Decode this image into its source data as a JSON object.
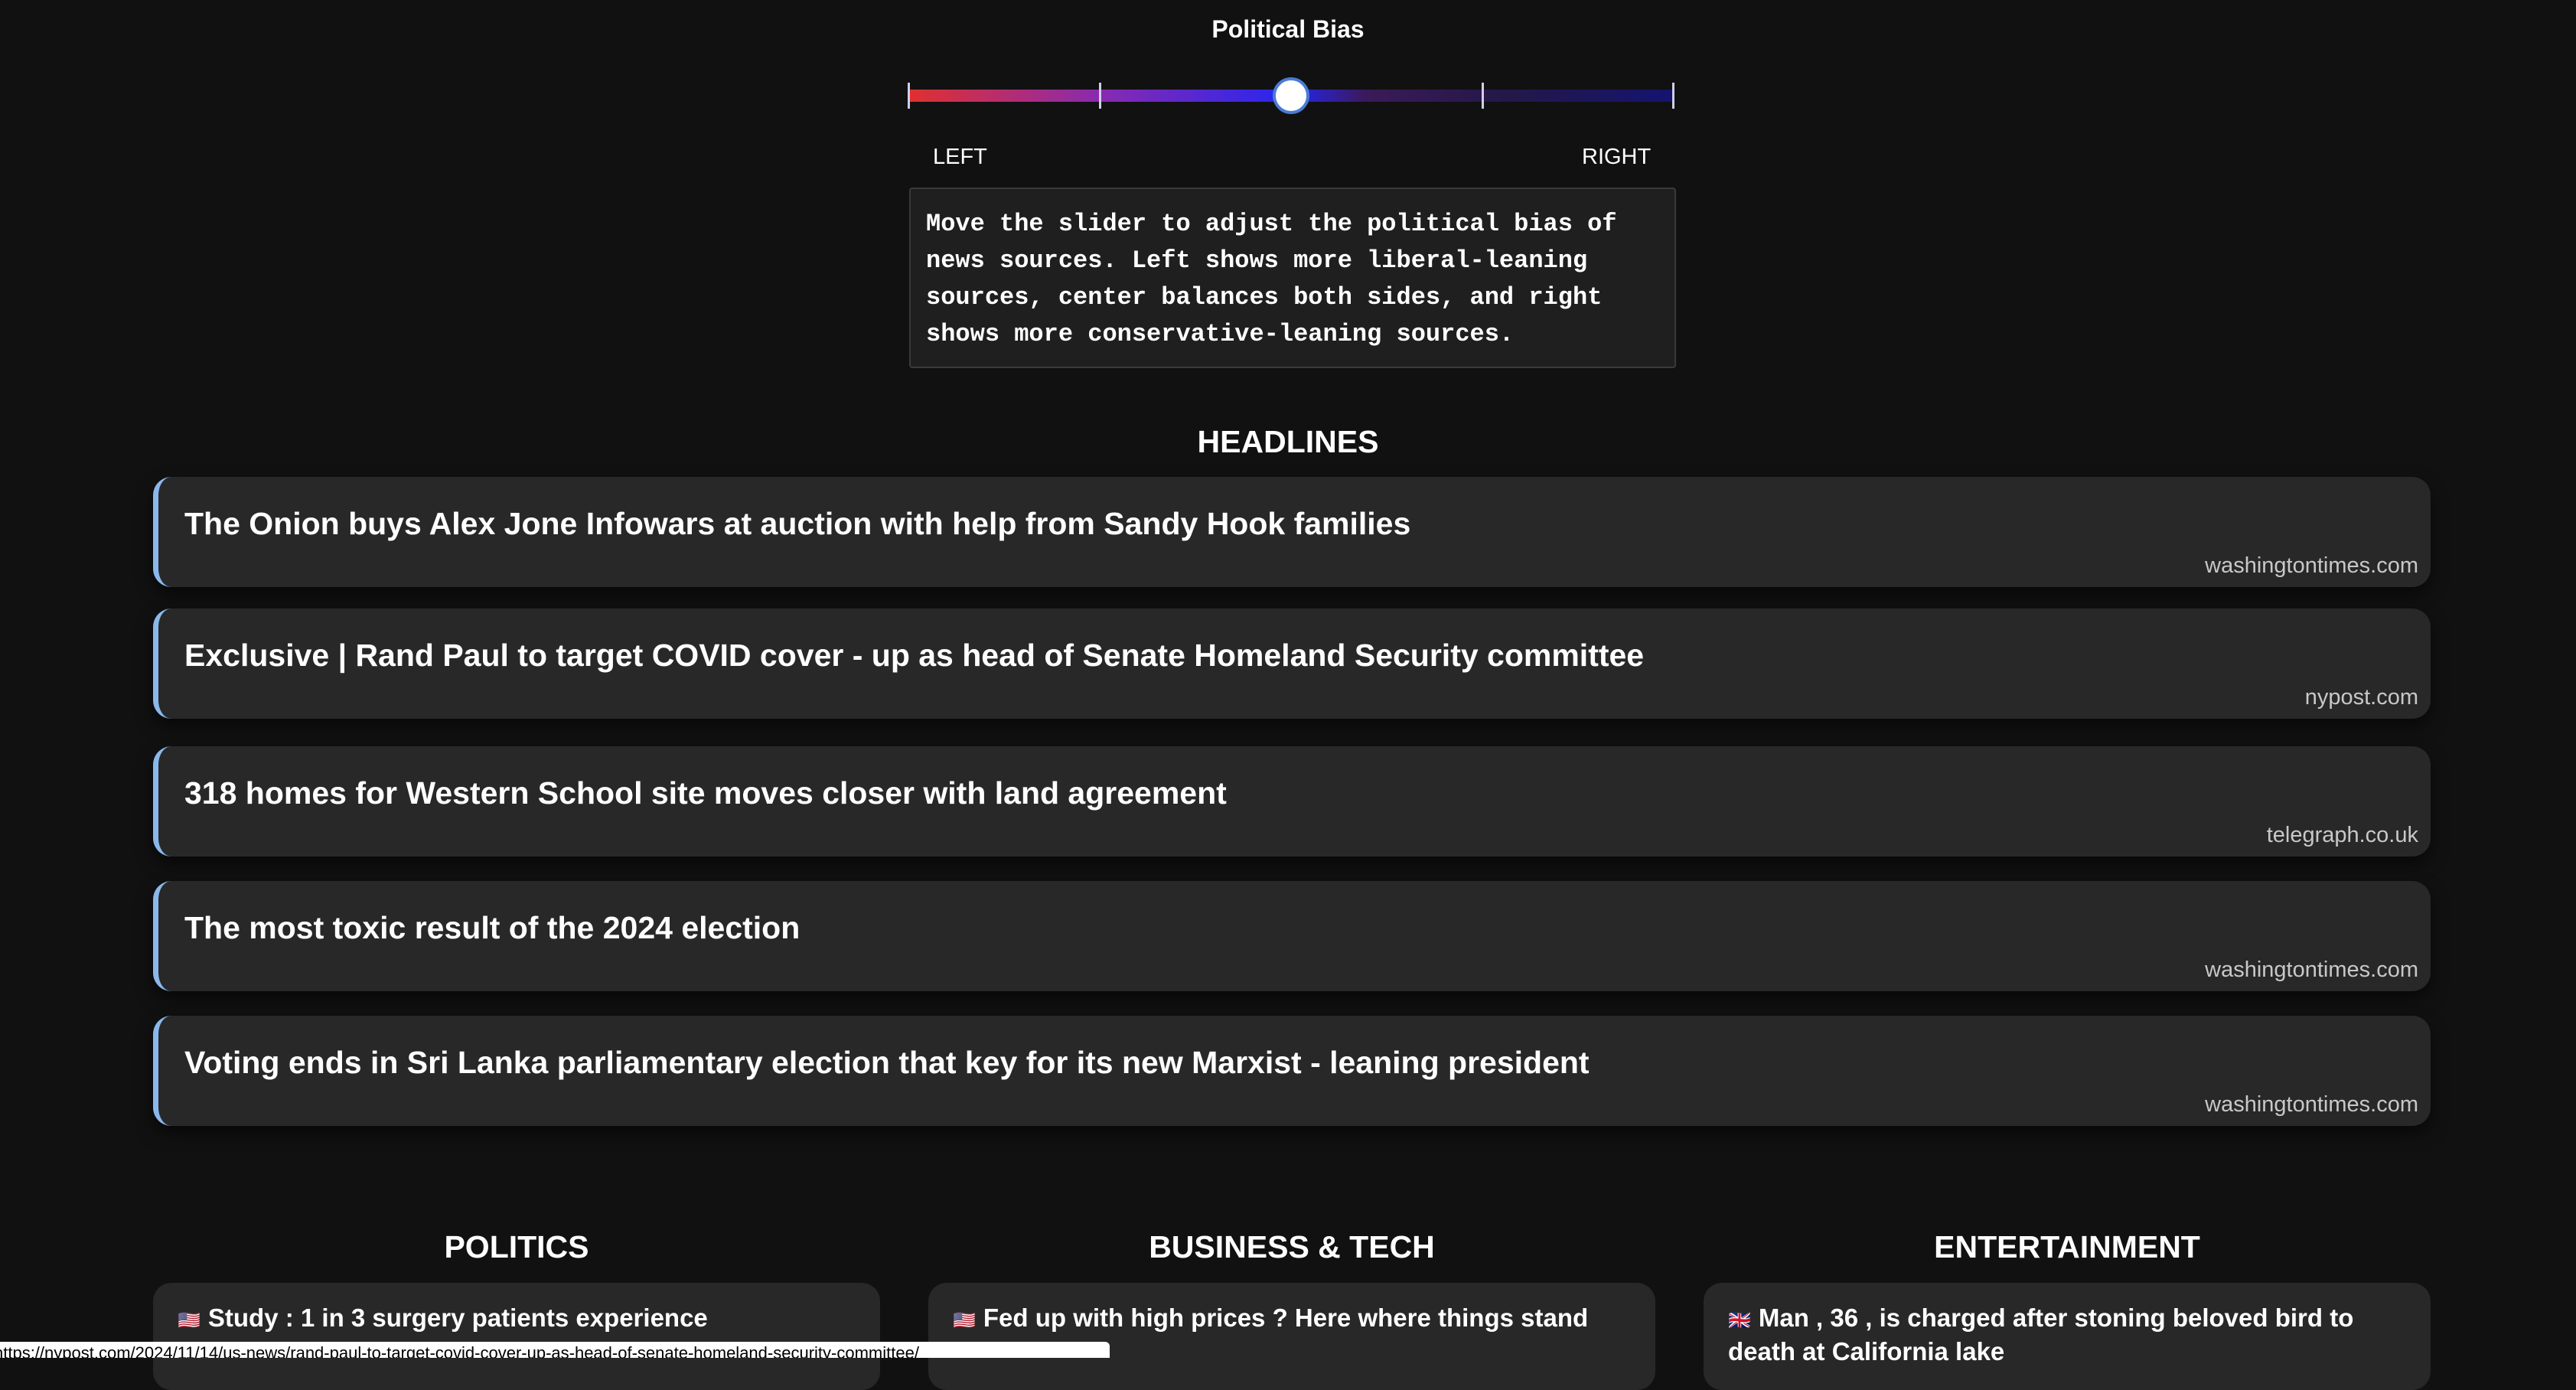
{
  "bias": {
    "title": "Political Bias",
    "left_label": "LEFT",
    "right_label": "RIGHT",
    "level_fraction": 0.5,
    "description": "Move the slider to adjust the political bias of news sources. Left shows more liberal-leaning sources, center balances both sides, and right shows more conservative-leaning sources."
  },
  "headlines": {
    "title": "HEADLINES",
    "items": [
      {
        "title": "The Onion buys Alex Jone Infowars at auction with help from Sandy Hook families",
        "source": "washingtontimes.com"
      },
      {
        "title": "Exclusive | Rand Paul to target COVID cover - up as head of Senate Homeland Security committee",
        "source": "nypost.com"
      },
      {
        "title": "318 homes for Western School site moves closer with land agreement",
        "source": "telegraph.co.uk"
      },
      {
        "title": "The most toxic result of the 2024 election",
        "source": "washingtontimes.com"
      },
      {
        "title": "Voting ends in Sri Lanka parliamentary election that key for its new Marxist - leaning president",
        "source": "washingtontimes.com"
      }
    ]
  },
  "sections": [
    {
      "title": "POLITICS",
      "flag": "🇺🇸",
      "first_item": "Study : 1 in 3 surgery patients experience"
    },
    {
      "title": "BUSINESS & TECH",
      "flag": "🇺🇸",
      "first_item": "Fed up with high prices ? Here where things stand"
    },
    {
      "title": "ENTERTAINMENT",
      "flag": "🇬🇧",
      "first_item": "Man , 36 , is charged after stoning beloved bird to death at California lake"
    }
  ],
  "status_url": "https://nypost.com/2024/11/14/us-news/rand-paul-to-target-covid-cover-up-as-head-of-senate-homeland-security-committee/",
  "colors": {
    "accent": "#8ab8ec",
    "thumb_border": "#4a7bd8",
    "background": "#111111",
    "card": "#282828"
  }
}
